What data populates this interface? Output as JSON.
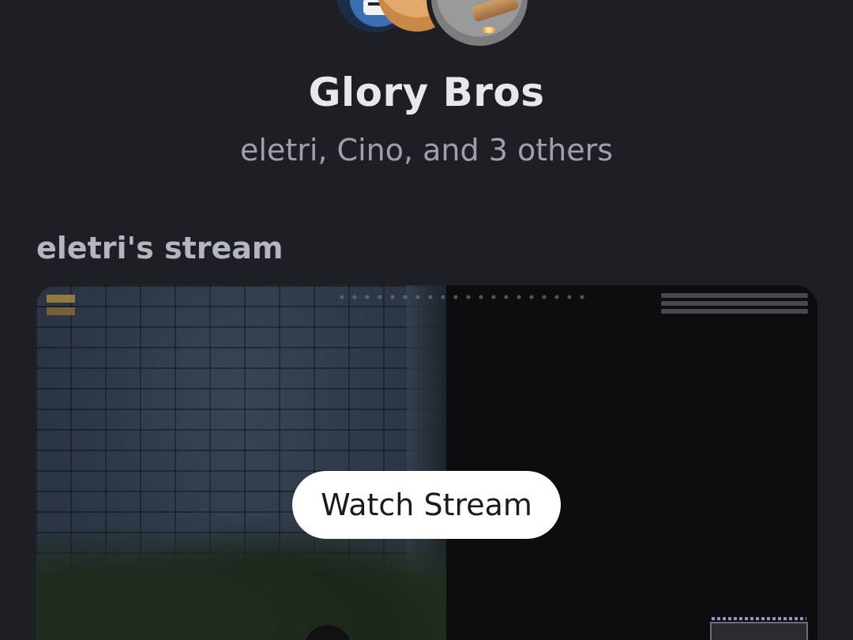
{
  "group": {
    "title": "Glory Bros",
    "members_summary": "eletri, Cino, and 3 others",
    "avatars": [
      "avatar-robot",
      "avatar-portrait",
      "avatar-jet"
    ]
  },
  "stream": {
    "heading": "eletri's stream",
    "watch_label": "Watch Stream"
  },
  "colors": {
    "background": "#1e1f24",
    "title": "#e7e8ec",
    "subtitle": "#9ea1ab",
    "button_bg": "#ffffff",
    "button_text": "#1a1b1e"
  }
}
